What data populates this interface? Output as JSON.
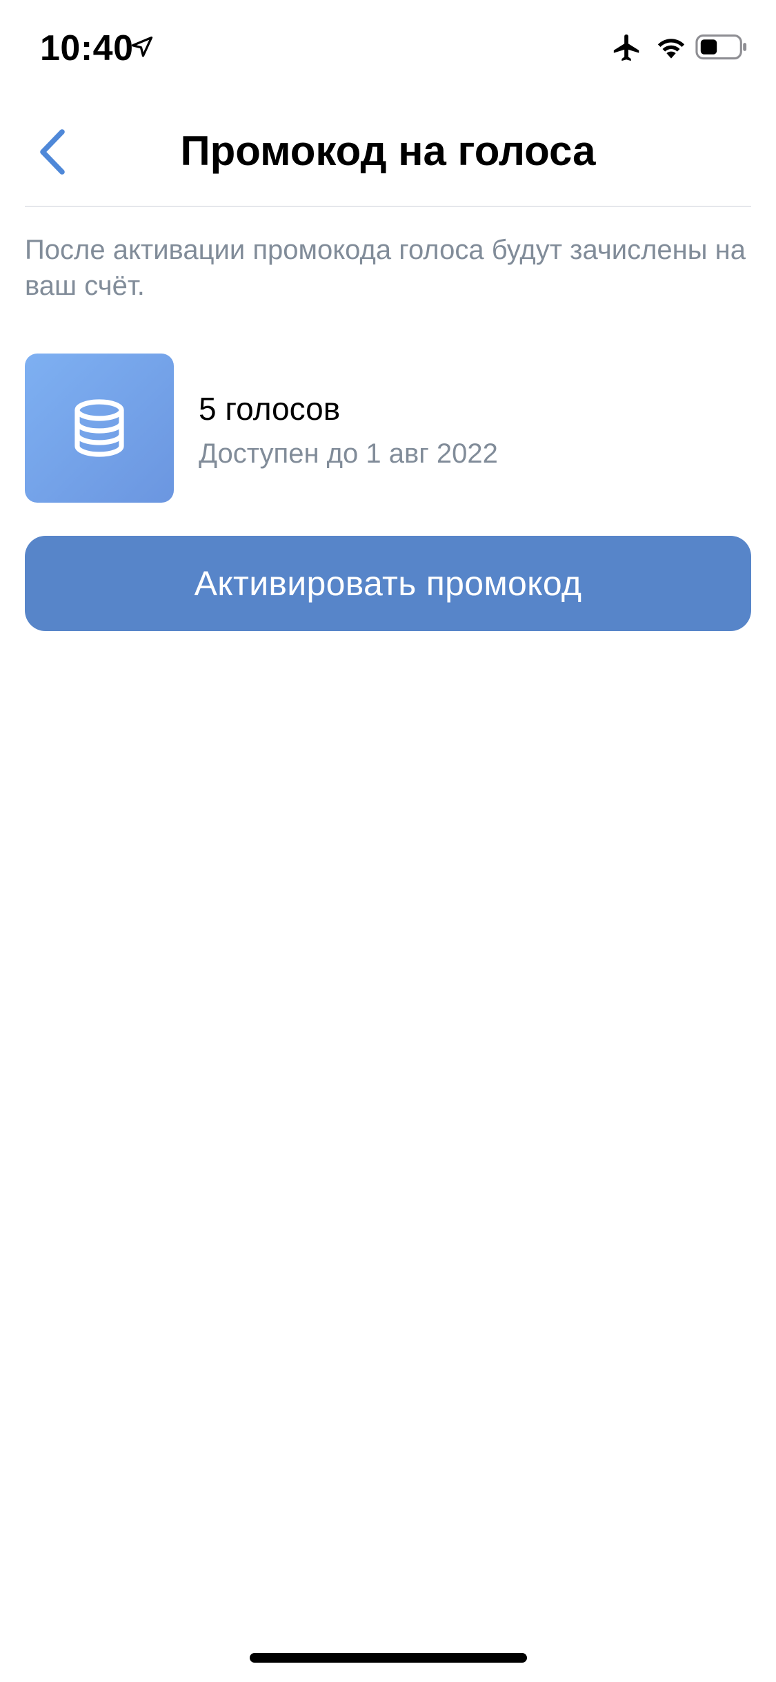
{
  "status_bar": {
    "time": "10:40",
    "icons": [
      "location-arrow-icon",
      "airplane-icon",
      "wifi-icon",
      "battery-icon"
    ]
  },
  "nav": {
    "back_icon": "chevron-left-icon",
    "title": "Промокод на голоса"
  },
  "description": "После активации промокода голоса будут зачислены на ваш счёт.",
  "promo": {
    "icon": "coins-stack-icon",
    "title": "5 голосов",
    "subtitle": "Доступен до 1 авг 2022"
  },
  "activate_button_label": "Активировать промокод",
  "colors": {
    "accent": "#5785c9",
    "back_chevron": "#4f88d8",
    "tile_gradient_start": "#7eb0f2",
    "tile_gradient_end": "#6b96e0",
    "secondary_text": "#818c99"
  }
}
